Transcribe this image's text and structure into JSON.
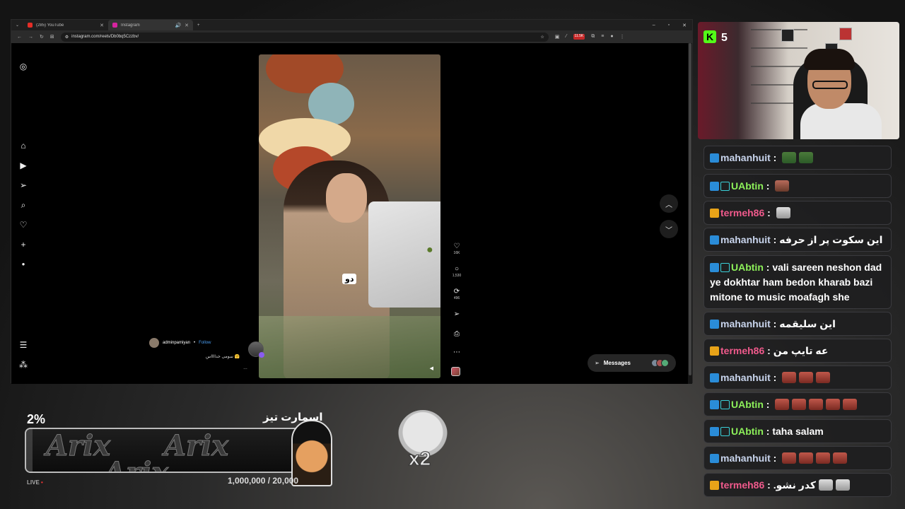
{
  "browser": {
    "tabs": [
      {
        "label": "(285) YouTube",
        "active": false,
        "favicon_color": "#e52d27"
      },
      {
        "label": "Instagram",
        "active": true,
        "favicon_color": "#d6249f"
      }
    ],
    "url": "instagram.com/reels/Db0bq5Czzbv/",
    "ext_badge": "11.5K"
  },
  "instagram": {
    "reel": {
      "on_screen_text": "دو",
      "author": "adminpamiyan",
      "follow_label": "Follow",
      "caption": "سومی خدااااس 🤗",
      "likes": "16K",
      "comments": "1,530",
      "reposts": "496"
    },
    "messages_label": "Messages"
  },
  "stream": {
    "kick_viewers": "5",
    "chat": [
      {
        "user": "mahanhuit",
        "text": "",
        "user_color": "blue",
        "badges": [
          "blue"
        ],
        "emotes": [
          "frog",
          "frog"
        ]
      },
      {
        "user": "UAbtin",
        "text": "",
        "user_color": "green",
        "badges": [
          "blue",
          "sub"
        ],
        "emotes": [
          "hand"
        ]
      },
      {
        "user": "termeh86",
        "text": "",
        "user_color": "pink",
        "badges": [
          "gold"
        ],
        "emotes": [
          "cat"
        ]
      },
      {
        "user": "mahanhuit",
        "text": "این سکوت پر از حرفه",
        "user_color": "blue",
        "badges": [
          "blue"
        ],
        "emotes": []
      },
      {
        "user": "UAbtin",
        "text": "vali sareen neshon dad ye dokhtar ham bedon kharab bazi mitone to music moafagh she",
        "user_color": "green",
        "badges": [
          "blue",
          "sub"
        ],
        "emotes": []
      },
      {
        "user": "mahanhuit",
        "text": "این سلیقمه",
        "user_color": "blue",
        "badges": [
          "blue"
        ],
        "emotes": []
      },
      {
        "user": "termeh86",
        "text": "عه تایپ من",
        "user_color": "pink",
        "badges": [
          "gold"
        ],
        "emotes": []
      },
      {
        "user": "mahanhuit",
        "text": "",
        "user_color": "blue",
        "badges": [
          "blue"
        ],
        "emotes": [
          "face",
          "face",
          "face"
        ]
      },
      {
        "user": "UAbtin",
        "text": "",
        "user_color": "green",
        "badges": [
          "blue",
          "sub"
        ],
        "emotes": [
          "face",
          "face",
          "face",
          "face",
          "face"
        ]
      },
      {
        "user": "UAbtin",
        "text": "taha salam",
        "user_color": "green",
        "badges": [
          "blue",
          "sub"
        ],
        "emotes": []
      },
      {
        "user": "mahanhuit",
        "text": "",
        "user_color": "blue",
        "badges": [
          "blue"
        ],
        "emotes": [
          "face",
          "face",
          "face",
          "face"
        ]
      },
      {
        "user": "termeh86",
        "text": ".کدر نشو",
        "user_color": "pink",
        "badges": [
          "gold"
        ],
        "emotes": [
          "cat",
          "cat"
        ]
      }
    ],
    "goal": {
      "percent_label": "2%",
      "percent": 2,
      "title": "اسمارت تیز",
      "count": "1,000,000 / 20,000",
      "watermark": "Arix",
      "live_label": "LIVE"
    },
    "meme_label": "x2"
  },
  "colors": {
    "kick_green": "#53fc18",
    "ig_blue": "#4a9cf0",
    "user_blue": "#c8d4ec",
    "user_green": "#8df05a",
    "user_pink": "#f05a8c"
  }
}
